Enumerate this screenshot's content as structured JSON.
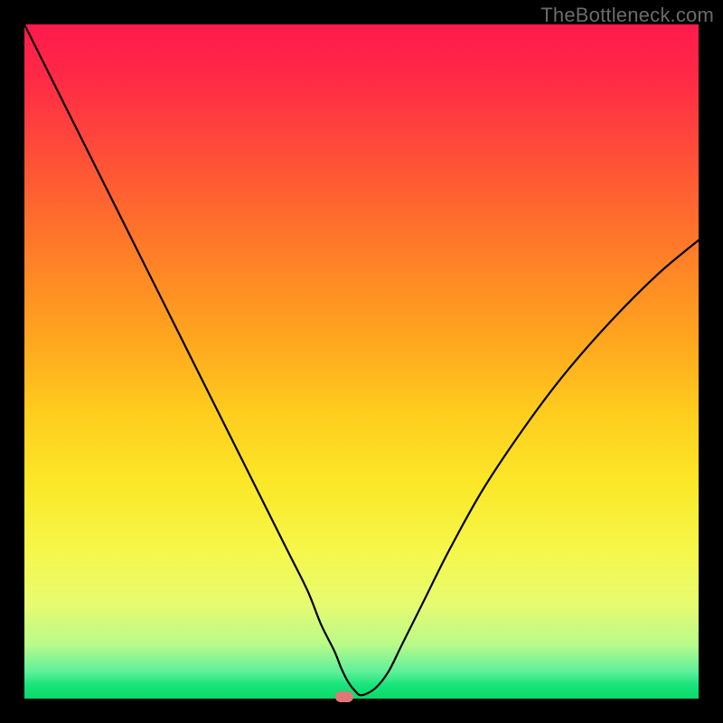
{
  "watermark": "TheBottleneck.com",
  "chart_data": {
    "type": "line",
    "title": "",
    "xlabel": "",
    "ylabel": "",
    "xlim": [
      0,
      100
    ],
    "ylim": [
      0,
      100
    ],
    "series": [
      {
        "name": "bottleneck-curve",
        "x": [
          0,
          3,
          6,
          9,
          12,
          15,
          18,
          21,
          24,
          27,
          30,
          33,
          36,
          39,
          42,
          44,
          46,
          47,
          48,
          49,
          50,
          52,
          54,
          56,
          59,
          63,
          68,
          74,
          80,
          87,
          94,
          100
        ],
        "values": [
          100,
          94,
          88,
          82,
          76,
          70,
          64,
          58,
          52,
          46,
          40,
          34,
          28,
          22,
          16,
          11,
          7,
          4.5,
          2.5,
          1.2,
          0.5,
          1.5,
          4,
          8,
          14,
          22,
          31,
          40,
          48,
          56,
          63,
          68
        ]
      }
    ],
    "marker": {
      "x": 47.5,
      "y": 0.3,
      "color": "#e17878"
    },
    "background_gradient": {
      "top": "#ff1a4c",
      "mid": "#ffe128",
      "bottom": "#0cd968"
    }
  }
}
